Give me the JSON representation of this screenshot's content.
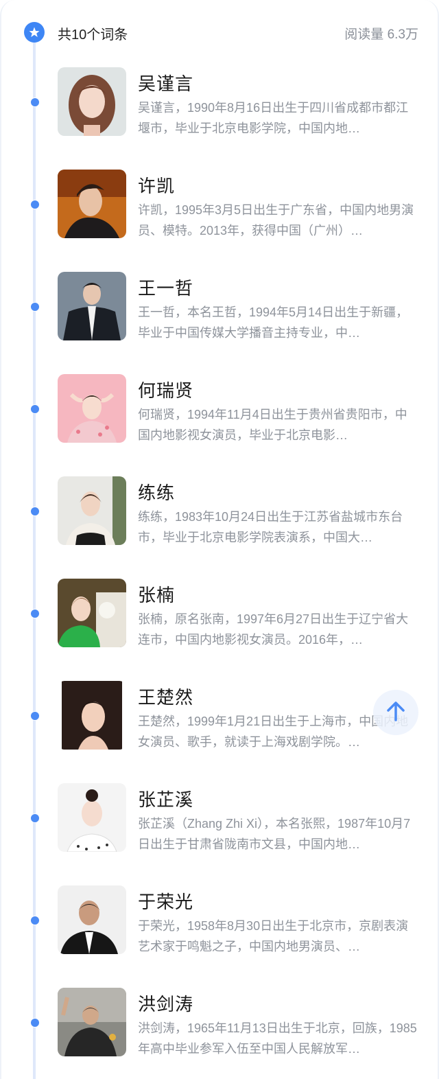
{
  "header": {
    "icon": "star-link-icon",
    "title": "共10个词条",
    "reads": "阅读量 6.3万",
    "accent": "#3e86f5"
  },
  "entries": [
    {
      "name": "吴谨言",
      "desc": "吴谨言，1990年8月16日出生于四川省成都市都江堰市，毕业于北京电影学院，中国内地…"
    },
    {
      "name": "许凯",
      "desc": "许凯，1995年3月5日出生于广东省，中国内地男演员、模特。2013年，获得中国（广州）…"
    },
    {
      "name": "王一哲",
      "desc": "王一哲，本名王哲，1994年5月14日出生于新疆，毕业于中国传媒大学播音主持专业，中…"
    },
    {
      "name": "何瑞贤",
      "desc": "何瑞贤，1994年11月4日出生于贵州省贵阳市，中国内地影视女演员，毕业于北京电影…"
    },
    {
      "name": "练练",
      "desc": "练练，1983年10月24日出生于江苏省盐城市东台市，毕业于北京电影学院表演系，中国大…"
    },
    {
      "name": "张楠",
      "desc": "张楠，原名张南，1997年6月27日出生于辽宁省大连市，中国内地影视女演员。2016年，…"
    },
    {
      "name": "王楚然",
      "desc": "王楚然，1999年1月21日出生于上海市，中国内地女演员、歌手，就读于上海戏剧学院。…"
    },
    {
      "name": "张芷溪",
      "desc": "张芷溪（Zhang Zhi Xi），本名张熙，1987年10月7日出生于甘肃省陇南市文县，中国内地…"
    },
    {
      "name": "于荣光",
      "desc": "于荣光，1958年8月30日出生于北京市，京剧表演艺术家于鸣魁之子，中国内地男演员、…"
    },
    {
      "name": "洪剑涛",
      "desc": "洪剑涛，1965年11月13日出生于北京，回族，1985年高中毕业参军入伍至中国人民解放军…"
    }
  ],
  "scroll_top_icon": "arrow-up-icon"
}
